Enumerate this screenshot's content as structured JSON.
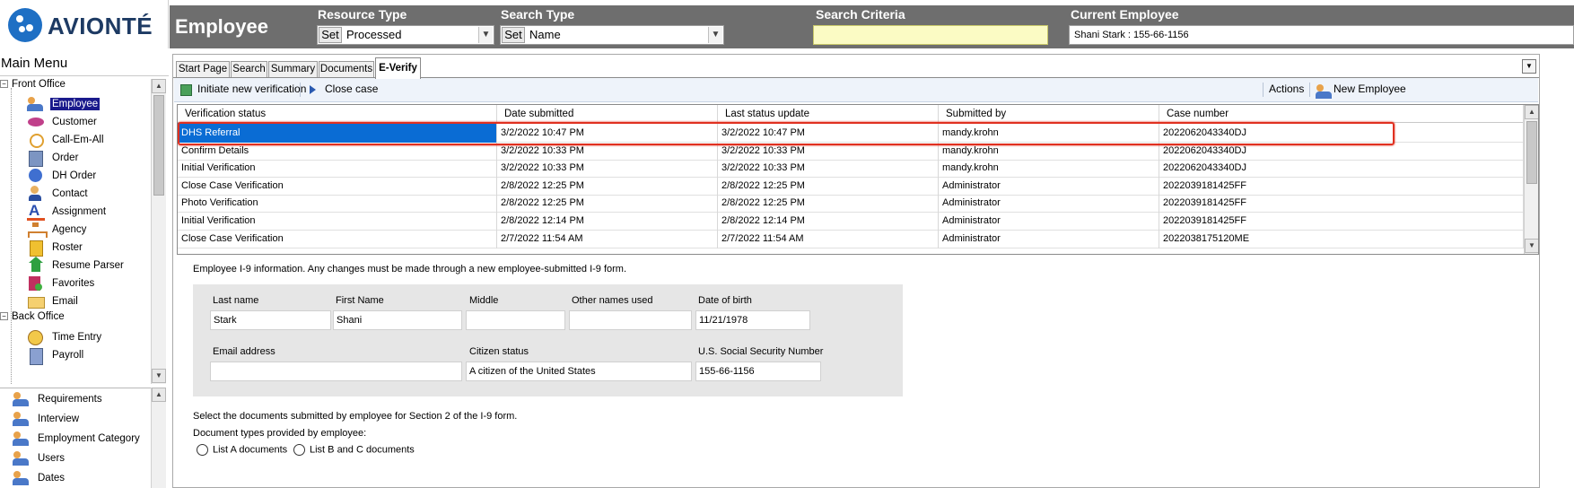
{
  "brand": {
    "logo_text": "AVIONTÉ"
  },
  "header": {
    "title": "Employee",
    "resource_type": {
      "label": "Resource Type",
      "set_label": "Set",
      "value": "Processed"
    },
    "search_type": {
      "label": "Search Type",
      "set_label": "Set",
      "value": "Name"
    },
    "search_criteria": {
      "label": "Search Criteria",
      "value": ""
    },
    "current_employee": {
      "label": "Current Employee",
      "value": "Shani  Stark : 155-66-1156"
    }
  },
  "menu": {
    "title": "Main Menu",
    "front_office": {
      "label": "Front Office",
      "items": [
        {
          "label": "Employee",
          "icon": "people-icon"
        },
        {
          "label": "Customer",
          "icon": "customer-icon"
        },
        {
          "label": "Call-Em-All",
          "icon": "phone-icon"
        },
        {
          "label": "Order",
          "icon": "order-icon"
        },
        {
          "label": "DH Order",
          "icon": "globe-icon"
        },
        {
          "label": "Contact",
          "icon": "contact-icon"
        },
        {
          "label": "Assignment",
          "icon": "assignment-icon"
        },
        {
          "label": "Agency",
          "icon": "agency-icon"
        },
        {
          "label": "Roster",
          "icon": "roster-icon"
        },
        {
          "label": "Resume Parser",
          "icon": "parser-icon"
        },
        {
          "label": "Favorites",
          "icon": "favorites-icon"
        },
        {
          "label": "Email",
          "icon": "email-icon"
        }
      ]
    },
    "back_office": {
      "label": "Back Office",
      "items": [
        {
          "label": "Time Entry",
          "icon": "time-entry-icon"
        },
        {
          "label": "Payroll",
          "icon": "payroll-icon"
        }
      ]
    },
    "secondary": [
      {
        "label": "Requirements"
      },
      {
        "label": "Interview"
      },
      {
        "label": "Employment Category"
      },
      {
        "label": "Users"
      },
      {
        "label": "Dates"
      }
    ]
  },
  "tabs": [
    {
      "label": "Start Page"
    },
    {
      "label": "Search"
    },
    {
      "label": "Summary"
    },
    {
      "label": "Documents"
    },
    {
      "label": "E-Verify",
      "active": true
    }
  ],
  "toolbar": {
    "initiate": "Initiate new verification",
    "close_case": "Close case",
    "actions": "Actions",
    "new_employee": "New Employee"
  },
  "grid": {
    "columns": [
      "Verification status",
      "Date submitted",
      "Last status update",
      "Submitted by",
      "Case number"
    ],
    "rows": [
      [
        "DHS Referral",
        "3/2/2022 10:47 PM",
        "3/2/2022 10:47 PM",
        "mandy.krohn",
        "2022062043340DJ"
      ],
      [
        "Confirm Details",
        "3/2/2022 10:33 PM",
        "3/2/2022 10:33 PM",
        "mandy.krohn",
        "2022062043340DJ"
      ],
      [
        "Initial Verification",
        "3/2/2022 10:33 PM",
        "3/2/2022 10:33 PM",
        "mandy.krohn",
        "2022062043340DJ"
      ],
      [
        "Close Case Verification",
        "2/8/2022 12:25 PM",
        "2/8/2022 12:25 PM",
        "Administrator",
        "2022039181425FF"
      ],
      [
        "Photo Verification",
        "2/8/2022 12:25 PM",
        "2/8/2022 12:25 PM",
        "Administrator",
        "2022039181425FF"
      ],
      [
        "Initial Verification",
        "2/8/2022 12:14 PM",
        "2/8/2022 12:14 PM",
        "Administrator",
        "2022039181425FF"
      ],
      [
        "Close Case Verification",
        "2/7/2022 11:54 AM",
        "2/7/2022 11:54 AM",
        "Administrator",
        "2022038175120ME"
      ]
    ]
  },
  "i9": {
    "note": "Employee I-9 information. Any changes must be made through a new employee-submitted I-9 form.",
    "last_name": {
      "label": "Last name",
      "value": "Stark"
    },
    "first_name": {
      "label": "First Name",
      "value": "Shani"
    },
    "middle": {
      "label": "Middle",
      "value": ""
    },
    "other_names": {
      "label": "Other names used",
      "value": ""
    },
    "dob": {
      "label": "Date of birth",
      "value": "11/21/1978"
    },
    "email": {
      "label": "Email address",
      "value": ""
    },
    "citizen_status": {
      "label": "Citizen status",
      "value": "A citizen of the United States"
    },
    "ssn": {
      "label": "U.S. Social Security Number",
      "value": "155-66-1156"
    },
    "docs_note": "Select the documents submitted by employee for Section 2 of the I-9 form.",
    "doctypes_note": "Document types provided by employee:",
    "list_a": "List A documents",
    "list_bc": "List B and C documents"
  },
  "colors": {
    "accent": "#0a6cd4",
    "header_bg": "#6e6e6e",
    "highlight": "#e03020"
  }
}
